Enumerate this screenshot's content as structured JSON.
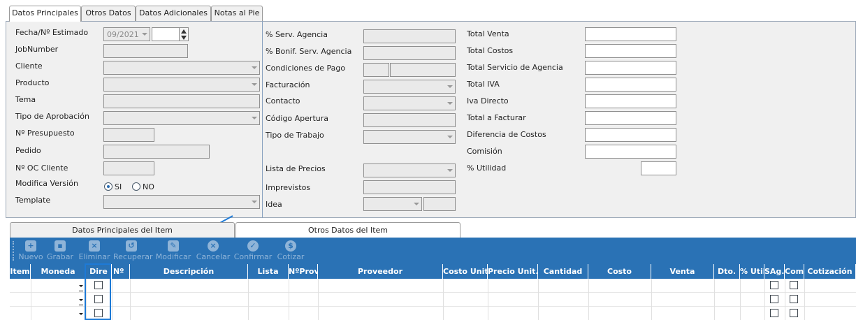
{
  "tabs": [
    "Datos Principales",
    "Otros Datos",
    "Datos Adicionales",
    "Notas al Pie"
  ],
  "left_labels": {
    "fecha": "Fecha/Nº Estimado",
    "jobnumber": "JobNumber",
    "cliente": "Cliente",
    "producto": "Producto",
    "tema": "Tema",
    "tipo_aprobacion": "Tipo de Aprobación",
    "presupuesto": "Nº Presupuesto",
    "pedido": "Pedido",
    "oc_cliente": "Nº OC Cliente",
    "modifica_version": "Modifica Versión",
    "template": "Template"
  },
  "fecha_value": "09/2021",
  "radio": {
    "si": "SI",
    "no": "NO",
    "selected": "si"
  },
  "mid_labels": {
    "serv_agencia": "% Serv. Agencia",
    "bonif": "% Bonif. Serv. Agencia",
    "condiciones": "Condiciones de Pago",
    "facturacion": "Facturación",
    "contacto": "Contacto",
    "codigo": "Código Apertura",
    "tipo_trabajo": "Tipo de Trabajo",
    "lista_precios": "Lista de Precios",
    "imprevistos": "Imprevistos",
    "idea": "Idea"
  },
  "right_labels": {
    "total_venta": "Total Venta",
    "total_costos": "Total Costos",
    "total_servicio": "Total Servicio de Agencia",
    "total_iva": "Total IVA",
    "iva_directo": "Iva Directo",
    "total_facturar": "Total a Facturar",
    "diferencia": "Diferencia de Costos",
    "comision": "Comisión",
    "utilidad": "% Utilidad"
  },
  "item_tabs": [
    "Datos Principales del Item",
    "Otros Datos del Item"
  ],
  "toolbar": [
    "Nuevo",
    "Grabar",
    "Eliminar",
    "Recuperar",
    "Modificar",
    "Cancelar",
    "Confirmar",
    "Cotizar"
  ],
  "grid_headers": [
    "Item",
    "Moneda",
    "Dire",
    "Nº",
    "Descripción",
    "Lista",
    "NºProv",
    "Proveedor",
    "Costo Unit.",
    "Precio Unit.",
    "Cantidad",
    "Costo",
    "Venta",
    "Dto.",
    "% Util",
    "SAg.",
    "Com",
    "Cotización"
  ],
  "colors": {
    "accent": "#2a72b5",
    "panel": "#f0f0f0",
    "highlight": "#1e7ad6"
  }
}
